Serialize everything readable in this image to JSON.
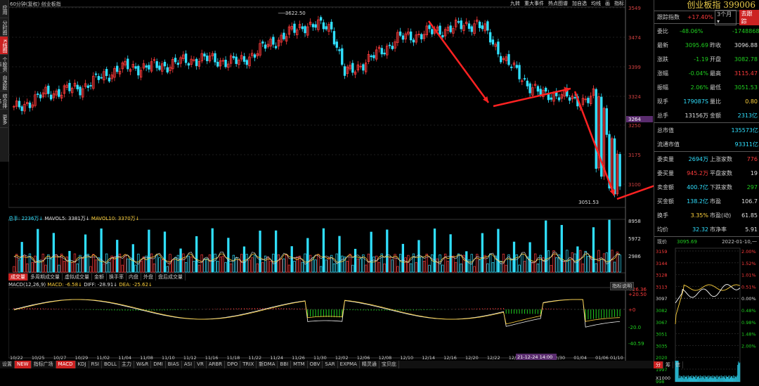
{
  "left_tabs": [
    "应用",
    "分时图",
    "K线图",
    "个股资料",
    "自选股",
    "综合排名",
    "更多"
  ],
  "left_tab_active": 2,
  "top_info": "60分钟(复权)  创业板指",
  "toolbar": [
    "九转",
    "重大事件",
    "热点图谱",
    "加自选",
    "均线",
    "画",
    "指标"
  ],
  "price_axis": [
    "3549",
    "3474",
    "3399",
    "3324",
    "3250",
    "3175",
    "3100"
  ],
  "current_price_tag": "3264",
  "high_label": "3622.50",
  "low_label": "3051.53",
  "volume_info": {
    "total": "总手: 2236万↓",
    "ma5": "MAVOL5: 3381万↓",
    "ma10": "MAVOL10: 3370万↓"
  },
  "volume_axis": [
    "8958",
    "5972",
    "2986"
  ],
  "vol_tabs": [
    "成交量",
    "多周期成交量",
    "虚拟成交量",
    "金额",
    "换手率",
    "内盘",
    "外盘",
    "盘后成交量"
  ],
  "vol_tab_active": 0,
  "macd_info": {
    "name": "MACD(12,26,9)",
    "macd": "MACD: -6.58↓",
    "diff": "DIFF: -28.91↓",
    "dea": "DEA: -25.62↓"
  },
  "macd_help": "指标说明",
  "macd_axis": [
    "+26.36",
    "+20.50",
    "+0",
    "-20.0",
    "-40.59"
  ],
  "date_axis": [
    "10/22",
    "10/25",
    "10/27",
    "10/29",
    "11/02",
    "11/04",
    "11/08",
    "11/10",
    "11/12",
    "11/16",
    "11/18",
    "11/22",
    "11/24",
    "11/26",
    "11/30",
    "12/02",
    "12/06",
    "12/08",
    "12/10",
    "12/14",
    "12/16",
    "12/20",
    "12/22",
    "12/24",
    "12/28",
    "12/30",
    "01/04",
    "01/06",
    "01/10"
  ],
  "date_highlight": "21-12-24 14:00",
  "bottom_tabs": [
    "设置",
    "NEW",
    "指标广场",
    "MACD",
    "KDJ",
    "RSI",
    "BOLL",
    "主力",
    "W&R",
    "DMI",
    "BIAS",
    "ASI",
    "VR",
    "ARBR",
    "DPO",
    "TRIX",
    "新DMA",
    "BBI",
    "MTM",
    "OBV",
    "SAR",
    "EXPMA",
    "精灵通",
    "宝贝庇"
  ],
  "bottom_tab_active": "MACD",
  "panel": {
    "title": "创业板指 399006",
    "track_label": "跟踪指数",
    "track_value": "+17.40%",
    "track_period": "3个月",
    "track_button": "去跟踪",
    "rows": [
      {
        "k": "委比",
        "v": "-48.06%",
        "vc": "green",
        "k2": "",
        "v2": "-17488682",
        "v2c": "green"
      },
      {
        "k": "最新",
        "v": "3095.69",
        "vc": "green",
        "k2": "昨收",
        "v2": "3096.88",
        "v2c": "white"
      },
      {
        "k": "涨跌",
        "v": "-1.19",
        "vc": "green",
        "k2": "开盘",
        "v2": "3082.78",
        "v2c": "green"
      },
      {
        "k": "涨幅",
        "v": "-0.04%",
        "vc": "green",
        "k2": "最高",
        "v2": "3115.47",
        "v2c": "red"
      },
      {
        "k": "振幅",
        "v": "2.06%",
        "vc": "green",
        "k2": "最低",
        "v2": "3051.53",
        "v2c": "green"
      },
      {
        "k": "现手",
        "v": "179087S",
        "vc": "cyan",
        "k2": "量比",
        "v2": "0.80",
        "v2c": "yellow"
      },
      {
        "k": "总手",
        "v": "13156万",
        "vc": "white",
        "k2": "金额",
        "v2": "2313亿",
        "v2c": "cyan"
      }
    ],
    "rows2": [
      {
        "k": "总市值",
        "v": "135573亿",
        "vc": "cyan"
      },
      {
        "k": "流通市值",
        "v": "93311亿",
        "vc": "cyan"
      }
    ],
    "rows3": [
      {
        "k": "委卖量",
        "v": "2694万",
        "vc": "cyan",
        "k2": "上涨家数",
        "v2": "776",
        "v2c": "red"
      },
      {
        "k": "委买量",
        "v": "945.2万",
        "vc": "red",
        "k2": "平盘家数",
        "v2": "19",
        "v2c": "white"
      },
      {
        "k": "卖金额",
        "v": "400.7亿",
        "vc": "cyan",
        "k2": "下跌家数",
        "v2": "297",
        "v2c": "green"
      },
      {
        "k": "买金额",
        "v": "138.2亿",
        "vc": "cyan",
        "k2": "市盈",
        "v2": "106.7",
        "v2c": "white"
      },
      {
        "k": "换手",
        "v": "3.35%",
        "vc": "yellow",
        "k2": "市盈(动)",
        "v2": "61.85",
        "v2c": "white"
      },
      {
        "k": "均价",
        "v": "32.32",
        "vc": "cyan",
        "k2": "市净率",
        "v2": "5.91",
        "v2c": "white"
      }
    ],
    "intraday_label": "现价",
    "intraday_price": "3095.69",
    "intraday_date": "2022-01-10,一",
    "intraday_left_axis": [
      "3159",
      "3144",
      "3128",
      "3113",
      "3097",
      "3082",
      "3067",
      "3051",
      "3035",
      "2020",
      "1997",
      "998"
    ],
    "intraday_right_axis": [
      "2.00%",
      "1.52%",
      "1.01%",
      "0.51%",
      "0.00%",
      "0.48%",
      "0.98%",
      "1.48%",
      "2.00%"
    ],
    "intraday_multiplier": "X1000",
    "panel_tabs": [
      "分",
      "筹",
      "信"
    ],
    "panel_tab_active": 0
  }
}
